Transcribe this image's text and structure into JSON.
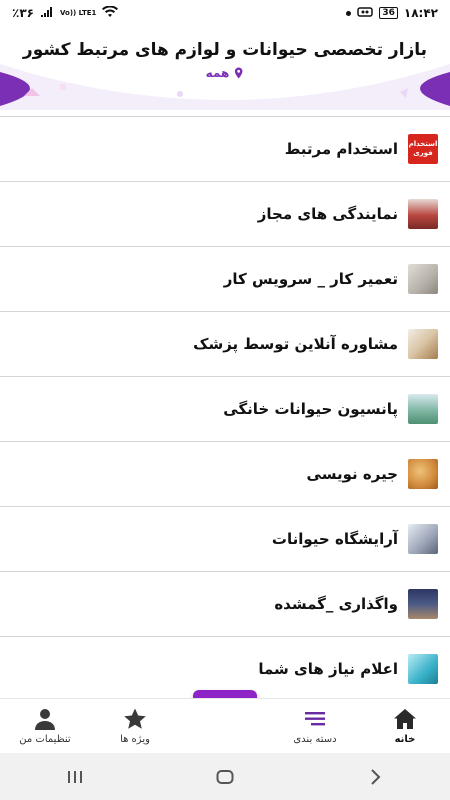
{
  "status_bar": {
    "battery_percent": "٪۳۶",
    "time": "۱۸:۴۲",
    "battery_box": "36",
    "network": "Vo)) LTE1"
  },
  "header": {
    "title": "بازار تخصصی حیوانات و لوازم های مرتبط کشور",
    "location": "همه"
  },
  "list": [
    {
      "label": "استخدام مرتبط",
      "thumb": "استخدام فوری",
      "color": "#d7261e"
    },
    {
      "label": "نمایندگی های مجاز",
      "thumb": "",
      "color": "#b8463f"
    },
    {
      "label": "تعمیر کار _ سرویس کار",
      "thumb": "",
      "color": "#b5b0a8"
    },
    {
      "label": "مشاوره آنلاین توسط پزشک",
      "thumb": "",
      "color": "#d9c4a5"
    },
    {
      "label": "پانسیون حیوانات خانگی",
      "thumb": "",
      "color": "#7fb7a3"
    },
    {
      "label": "جیره نویسی",
      "thumb": "",
      "color": "#d0893a"
    },
    {
      "label": "آرایشگاه حیوانات",
      "thumb": "",
      "color": "#9aa3b6"
    },
    {
      "label": "واگذاری _گمشده",
      "thumb": "",
      "color": "#4b5a86"
    },
    {
      "label": "اعلام نیاز های شما",
      "thumb": "",
      "color": "#38b1c9"
    }
  ],
  "bottom_nav": {
    "settings": "تنظیمات من",
    "featured": "ویژه ها",
    "add": "+",
    "categories": "دسته بندی",
    "home": "خانه"
  },
  "colors": {
    "accent": "#8e24c8",
    "accent_dark": "#7b2fb5"
  }
}
